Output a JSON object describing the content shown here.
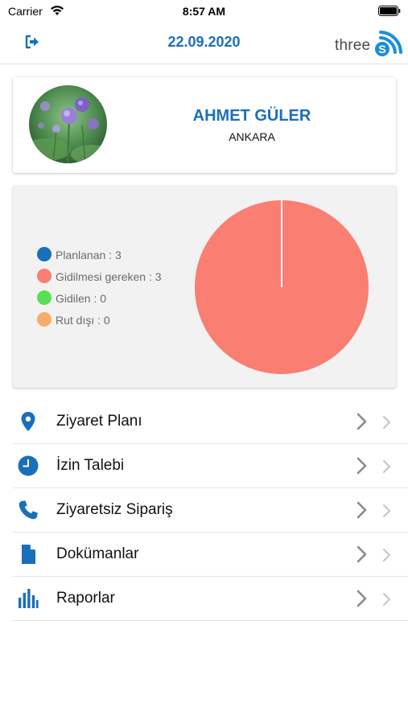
{
  "status_bar": {
    "carrier": "Carrier",
    "time": "8:57 AM"
  },
  "nav": {
    "title": "22.09.2020",
    "brand": "three",
    "brand_mark": "S"
  },
  "profile": {
    "name": "AHMET GÜLER",
    "city": "ANKARA"
  },
  "stats": {
    "legend": [
      {
        "label": "Planlanan : 3",
        "color": "#1a6fba"
      },
      {
        "label": "Gidilmesi gereken : 3",
        "color": "#fa7e71"
      },
      {
        "label": "Gidilen : 0",
        "color": "#58e054"
      },
      {
        "label": "Rut dışı : 0",
        "color": "#f9ad6a"
      }
    ]
  },
  "chart_data": {
    "type": "pie",
    "title": "",
    "categories": [
      "Planlanan",
      "Gidilmesi gereken",
      "Gidilen",
      "Rut dışı"
    ],
    "values": [
      0,
      3,
      0,
      0
    ],
    "colors": [
      "#1a6fba",
      "#fa7e71",
      "#58e054",
      "#f9ad6a"
    ]
  },
  "menu": {
    "items": [
      {
        "label": "Ziyaret Planı",
        "icon": "location-pin-icon"
      },
      {
        "label": "İzin Talebi",
        "icon": "clock-icon"
      },
      {
        "label": "Ziyaretsiz Sipariş",
        "icon": "phone-icon"
      },
      {
        "label": "Dokümanlar",
        "icon": "document-icon"
      },
      {
        "label": "Raporlar",
        "icon": "bar-chart-icon"
      }
    ]
  },
  "colors": {
    "accent": "#1a6fba",
    "divider": "#e3e3e3",
    "chevron": "#8a8a8a"
  }
}
